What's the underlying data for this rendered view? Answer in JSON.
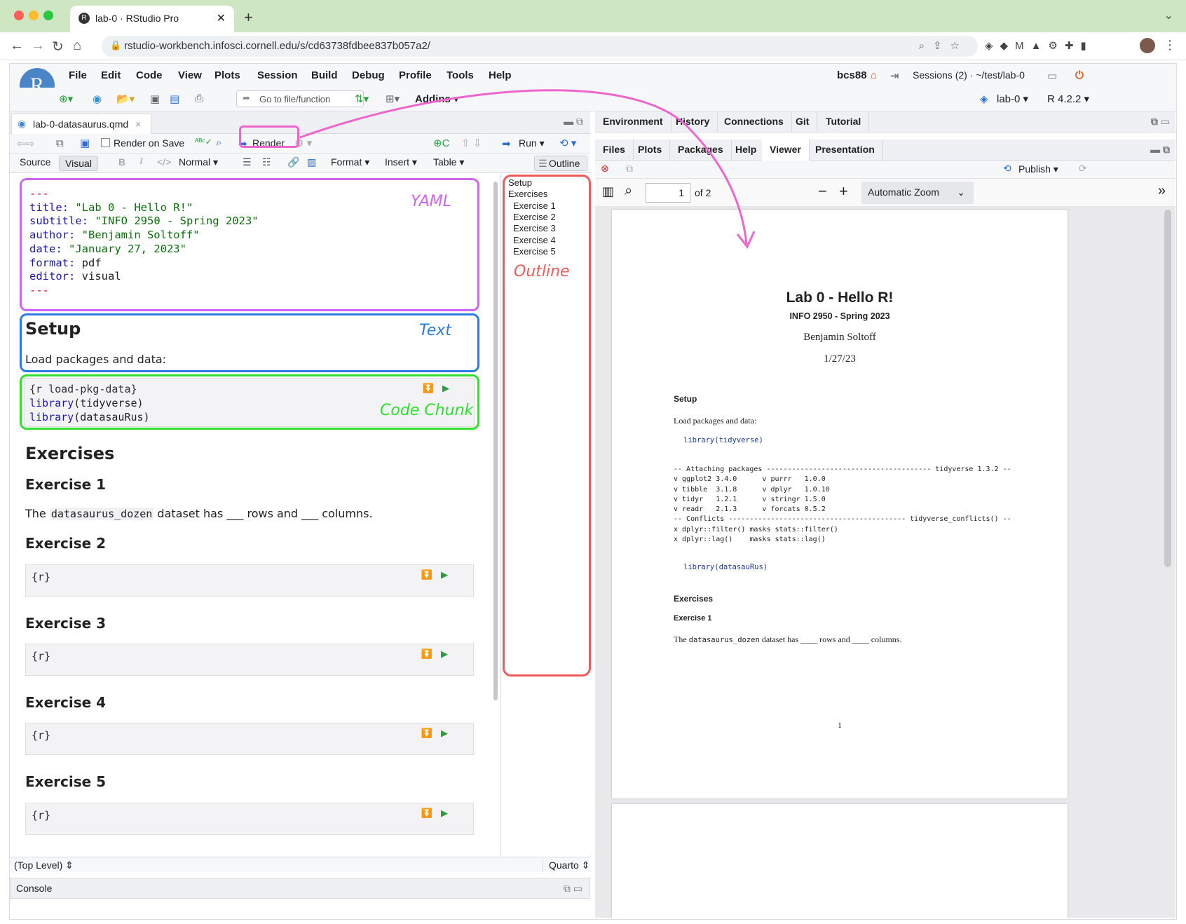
{
  "browser": {
    "tab_title": "lab-0 · RStudio Pro",
    "tab_icon": "R",
    "new_tab": "+",
    "url": "rstudio-workbench.infosci.cornell.edu/s/cd63738fdbee837b057a2/"
  },
  "rstudio": {
    "logo": "R",
    "menu": [
      "File",
      "Edit",
      "Code",
      "View",
      "Plots",
      "Session",
      "Build",
      "Debug",
      "Profile",
      "Tools",
      "Help"
    ],
    "user": "bcs88",
    "sessions": "Sessions (2) · ~/test/lab-0",
    "goto_file": "Go to file/function",
    "addins": "Addins",
    "project": "lab-0",
    "r_version": "R 4.2.2"
  },
  "editor": {
    "file_tab": "lab-0-datasaurus.qmd",
    "render_on_save": "Render on Save",
    "render": "Render",
    "run": "Run",
    "source": "Source",
    "visual": "Visual",
    "bold": "B",
    "italic": "I",
    "style": "Normal",
    "format": "Format",
    "insert": "Insert",
    "table": "Table",
    "outline": "Outline",
    "yaml_lines": [
      {
        "k": "---",
        "v": ""
      },
      {
        "k": "title:",
        "v": " \"Lab 0 - Hello R!\""
      },
      {
        "k": "subtitle:",
        "v": " \"INFO 2950 - Spring 2023\""
      },
      {
        "k": "author:",
        "v": " \"Benjamin Soltoff\""
      },
      {
        "k": "date:",
        "v": " \"January 27, 2023\""
      },
      {
        "k": "format:",
        "v": " pdf"
      },
      {
        "k": "editor:",
        "v": " visual"
      },
      {
        "k": "---",
        "v": ""
      }
    ],
    "setup_heading": "Setup",
    "setup_text": "Load packages and data:",
    "chunk1": [
      "{r load-pkg-data}",
      "library(tidyverse)",
      "library(datasauRus)"
    ],
    "chunk1_lib": "library",
    "chunk1_args": [
      "(tidyverse)",
      "(datasauRus)"
    ],
    "exercises_heading": "Exercises",
    "ex1_heading": "Exercise 1",
    "ex1_text_pre": "The ",
    "ex1_code": "datasaurus_dozen",
    "ex1_text_post": " dataset has ___ rows and ___ columns.",
    "ex2_heading": "Exercise 2",
    "ex3_heading": "Exercise 3",
    "ex4_heading": "Exercise 4",
    "ex5_heading": "Exercise 5",
    "empty_chunk": "{r}",
    "status_left": "(Top Level)",
    "status_right": "Quarto",
    "console": "Console"
  },
  "annotations": {
    "yaml": "YAML",
    "text": "Text",
    "code_chunk": "Code Chunk",
    "outline": "Outline",
    "colors": {
      "yaml": "#cc66ee",
      "text": "#2a7be4",
      "code": "#2fe02f",
      "outline": "#f05a5a",
      "render": "#ee66cc"
    }
  },
  "outline_items": [
    "Setup",
    "Exercises",
    "Exercise 1",
    "Exercise 2",
    "Exercise 3",
    "Exercise 4",
    "Exercise 5"
  ],
  "right": {
    "tabs_top": [
      "Environment",
      "History",
      "Connections",
      "Git",
      "Tutorial"
    ],
    "tabs_bottom": [
      "Files",
      "Plots",
      "Packages",
      "Help",
      "Viewer",
      "Presentation"
    ],
    "active_tab": "Viewer",
    "publish": "Publish",
    "page_number": "1",
    "page_count": "of 2",
    "zoom": "Automatic Zoom"
  },
  "pdf": {
    "title": "Lab 0 - Hello R!",
    "subtitle": "INFO 2950 - Spring 2023",
    "author": "Benjamin Soltoff",
    "date": "1/27/23",
    "setup": "Setup",
    "setup_text": "Load packages and data:",
    "code1": "library(tidyverse)",
    "output": "-- Attaching packages --------------------------------------- tidyverse 1.3.2 --\nv ggplot2 3.4.0      v purrr   1.0.0\nv tibble  3.1.8      v dplyr   1.0.10\nv tidyr   1.2.1      v stringr 1.5.0\nv readr   2.1.3      v forcats 0.5.2\n-- Conflicts ------------------------------------------ tidyverse_conflicts() --\nx dplyr::filter() masks stats::filter()\nx dplyr::lag()    masks stats::lag()",
    "code2": "library(datasauRus)",
    "exercises": "Exercises",
    "ex1": "Exercise 1",
    "ex1_pre": "The ",
    "ex1_code": "datasaurus_dozen",
    "ex1_post": " dataset has ____ rows and ____ columns.",
    "page_num": "1"
  }
}
